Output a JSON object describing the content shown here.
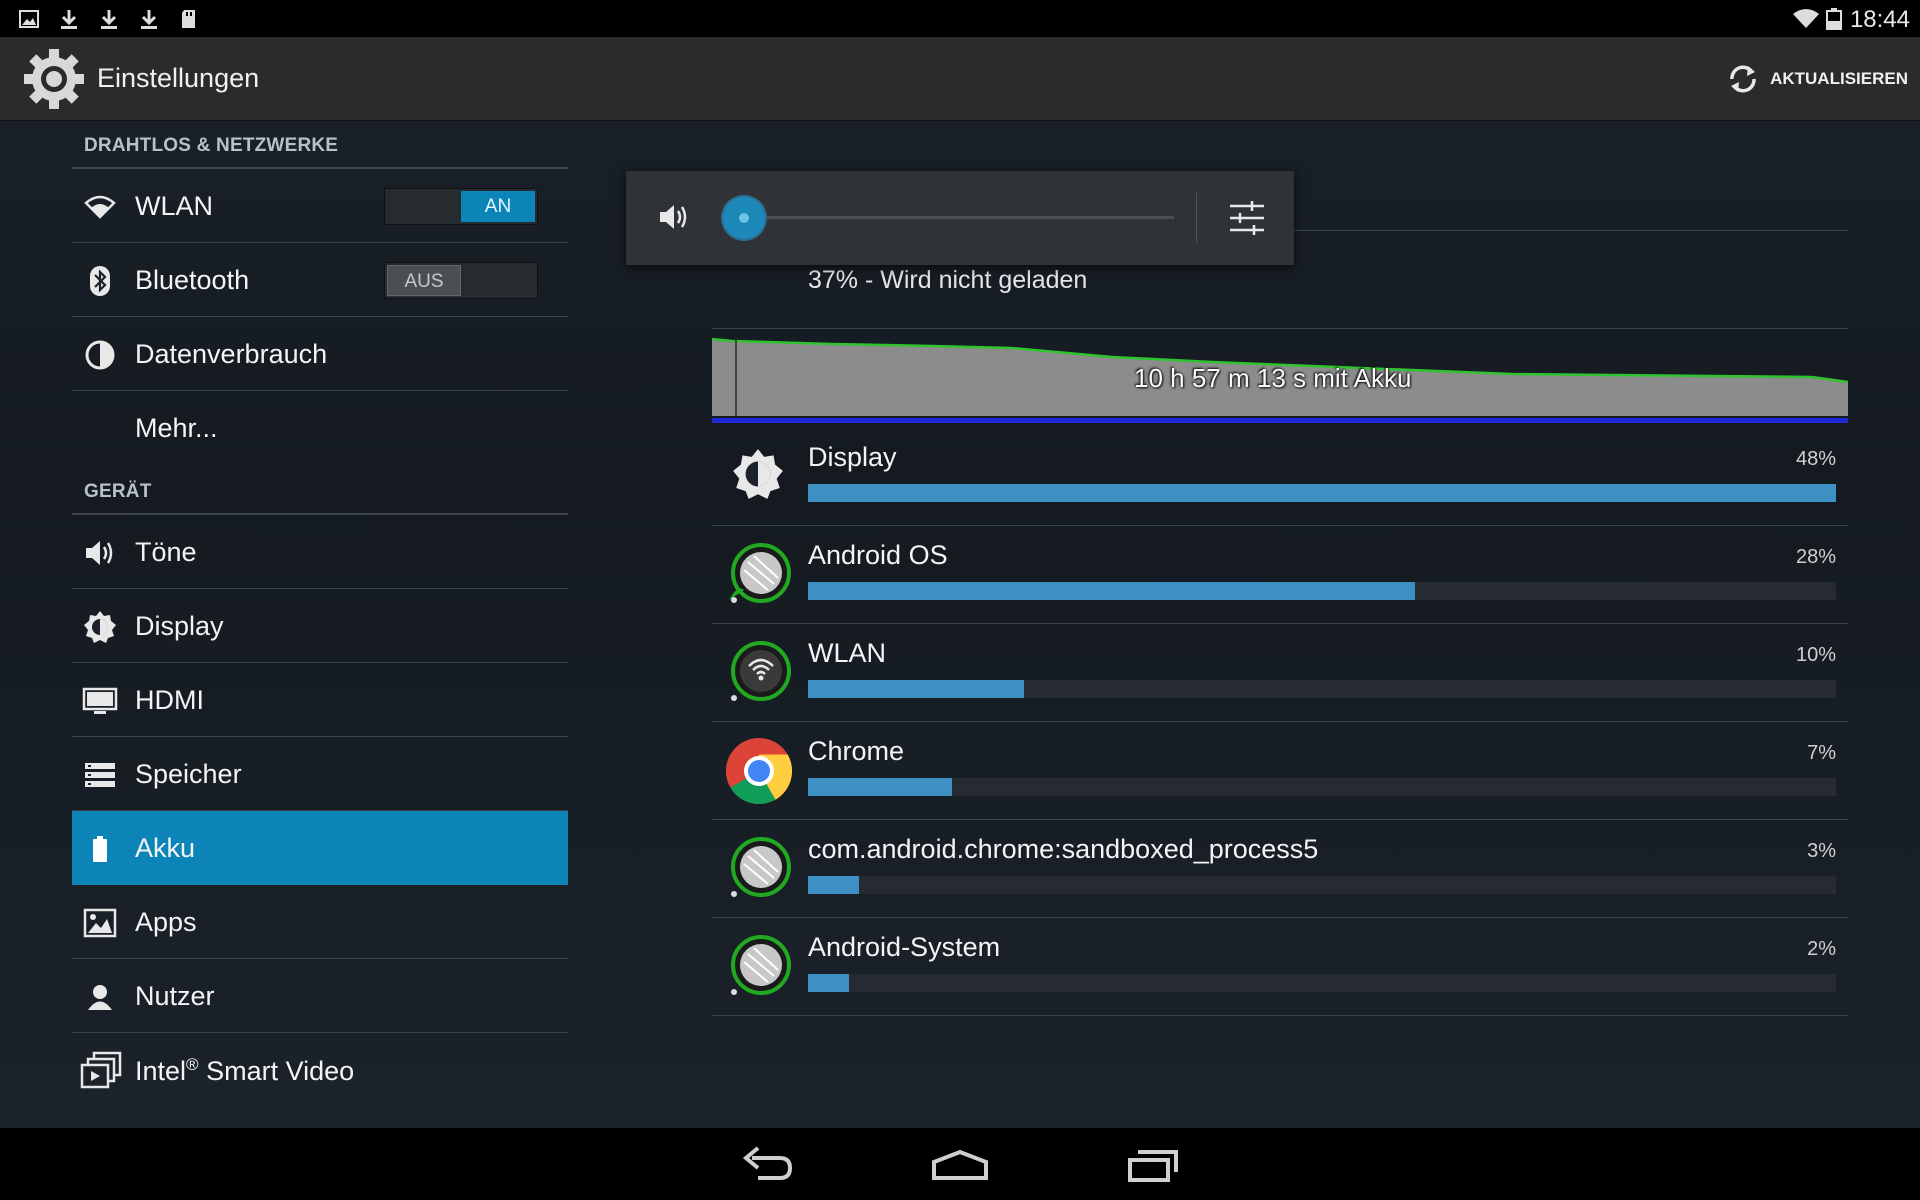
{
  "status_bar": {
    "time": "18:44",
    "left_icons": [
      "image-notification-icon",
      "download-icon",
      "download-icon",
      "download-icon",
      "sd-card-icon"
    ],
    "right_icons": [
      "wifi-signal-icon",
      "battery-icon"
    ]
  },
  "action_bar": {
    "title": "Einstellungen",
    "refresh_label": "AKTUALISIEREN"
  },
  "sidebar": {
    "section_wireless": "DRAHTLOS & NETZWERKE",
    "section_device": "GERÄT",
    "items": [
      {
        "label": "WLAN",
        "icon": "wifi-icon",
        "toggle": "AN"
      },
      {
        "label": "Bluetooth",
        "icon": "bluetooth-icon",
        "toggle": "AUS"
      },
      {
        "label": "Datenverbrauch",
        "icon": "data-usage-icon"
      },
      {
        "label": "Mehr...",
        "icon": ""
      },
      {
        "label": "Töne",
        "icon": "speaker-icon"
      },
      {
        "label": "Display",
        "icon": "brightness-icon"
      },
      {
        "label": "HDMI",
        "icon": "monitor-icon"
      },
      {
        "label": "Speicher",
        "icon": "storage-icon"
      },
      {
        "label": "Akku",
        "icon": "battery-icon",
        "selected": true
      },
      {
        "label": "Apps",
        "icon": "apps-icon"
      },
      {
        "label": "Nutzer",
        "icon": "user-icon"
      },
      {
        "label": "Intel",
        "label_sup": "®",
        "label_suffix": " Smart Video",
        "icon": "smart-video-icon"
      }
    ]
  },
  "battery": {
    "status": "37% - Wird nicht geladen",
    "graph_label": "10 h 57 m 13 s mit Akku",
    "usage": [
      {
        "name": "Display",
        "percent": "48%",
        "fraction": 1.0,
        "icon": "brightness-icon"
      },
      {
        "name": "Android OS",
        "percent": "28%",
        "fraction": 0.59,
        "icon": "android-os-icon"
      },
      {
        "name": "WLAN",
        "percent": "10%",
        "fraction": 0.21,
        "icon": "wlan-app-icon"
      },
      {
        "name": "Chrome",
        "percent": "7%",
        "fraction": 0.14,
        "icon": "chrome-icon"
      },
      {
        "name": "com.android.chrome:sandboxed_process5",
        "percent": "3%",
        "fraction": 0.05,
        "icon": "android-os-icon"
      },
      {
        "name": "Android-System",
        "percent": "2%",
        "fraction": 0.04,
        "icon": "android-os-icon"
      }
    ]
  },
  "volume_panel": {
    "level": 0.0
  },
  "colors": {
    "accent": "#0d84b7",
    "bar": "#3d8fc4",
    "graph_line": "#2fc42f"
  }
}
